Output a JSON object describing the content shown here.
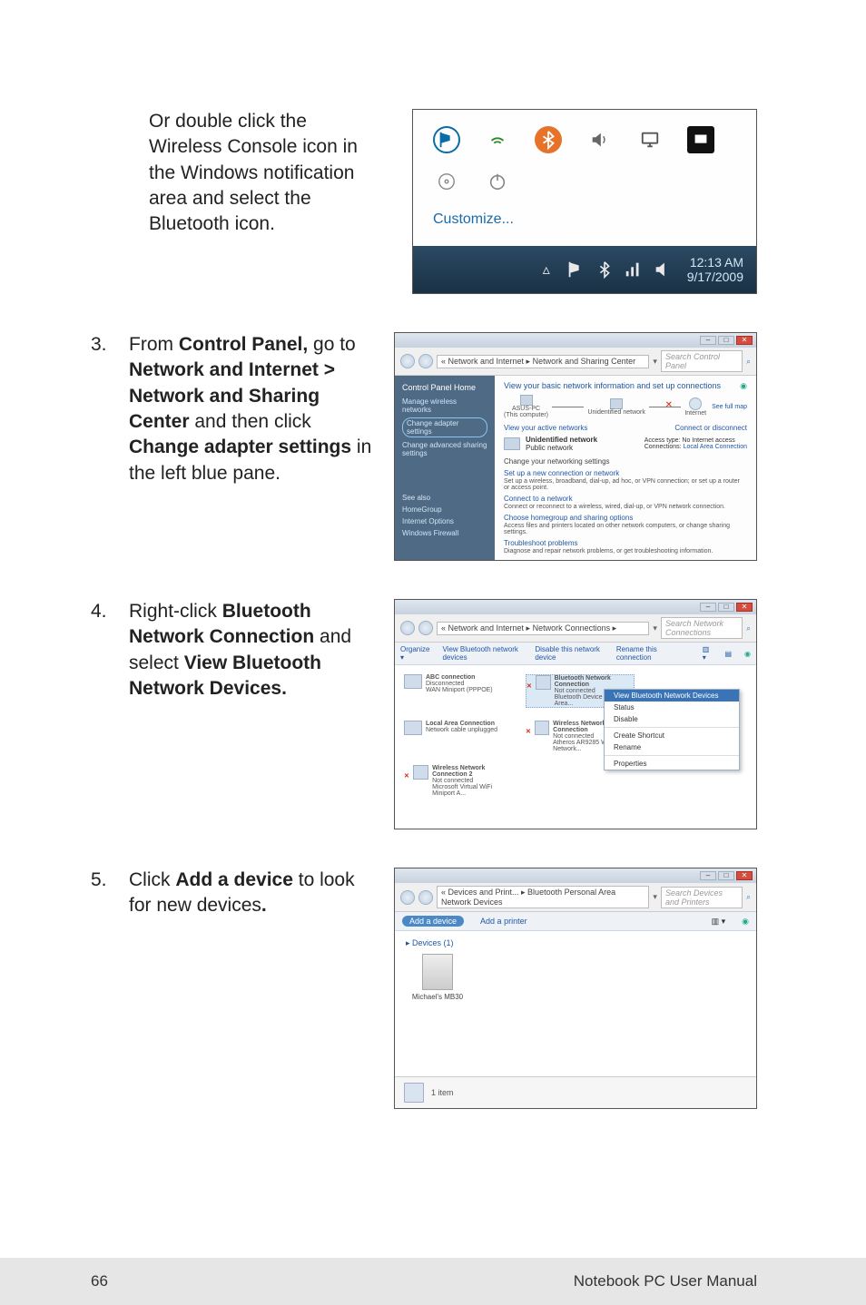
{
  "intro": {
    "text_a": "Or double click the Wireless Console icon in the Windows notification area and select the Bluetooth icon."
  },
  "tray": {
    "customize": "Customize...",
    "time": "12:13 AM",
    "date": "9/17/2009"
  },
  "step3": {
    "num": "3.",
    "t1": "From ",
    "b1": "Control Panel,",
    "t2": " go to ",
    "b2": "Network and Internet > Network and Sharing Center",
    "t3": " and then click ",
    "b3": "Change adapter settings",
    "t4": " in the left blue pane."
  },
  "nc": {
    "breadcrumb": "« Network and Internet ▸ Network and Sharing Center",
    "search": "Search Control Panel",
    "side_home": "Control Panel Home",
    "side_l1": "Manage wireless networks",
    "side_l2": "Change adapter settings",
    "side_l3": "Change advanced sharing settings",
    "see_also": "See also",
    "sa1": "HomeGroup",
    "sa2": "Internet Options",
    "sa3": "Windows Firewall",
    "top": "View your basic network information and set up connections",
    "fullmap": "See full map",
    "node1": "ASUS-PC",
    "node1b": "(This computer)",
    "node2": "Unidentified network",
    "node3": "Internet",
    "active_h": "View your active networks",
    "conn_disc": "Connect or disconnect",
    "net_name": "Unidentified network",
    "net_type": "Public network",
    "acc_type_l": "Access type:",
    "acc_type_v": "No Internet access",
    "conn_l": "Connections:",
    "conn_v": "Local Area Connection",
    "change_h": "Change your networking settings",
    "lk1": "Set up a new connection or network",
    "lk1d": "Set up a wireless, broadband, dial-up, ad hoc, or VPN connection; or set up a router or access point.",
    "lk2": "Connect to a network",
    "lk2d": "Connect or reconnect to a wireless, wired, dial-up, or VPN network connection.",
    "lk3": "Choose homegroup and sharing options",
    "lk3d": "Access files and printers located on other network computers, or change sharing settings.",
    "lk4": "Troubleshoot problems",
    "lk4d": "Diagnose and repair network problems, or get troubleshooting information."
  },
  "step4": {
    "num": "4.",
    "t1": "Right-click ",
    "b1": "Bluetooth Network Connection",
    "t2": " and select ",
    "b2": "View Bluetooth Network Devices."
  },
  "ncwin": {
    "breadcrumb": "« Network and Internet ▸ Network Connections ▸",
    "search": "Search Network Connections",
    "tb1": "Organize ▾",
    "tb2": "View Bluetooth network devices",
    "tb3": "Disable this network device",
    "tb4": "Rename this connection",
    "conn1_t": "ABC connection",
    "conn1_s": "Disconnected",
    "conn1_d": "WAN Miniport (PPPOE)",
    "conn2_t": "Bluetooth Network Connection",
    "conn2_s": "Not connected",
    "conn2_d": "Bluetooth Device (Personal Area...",
    "conn3_t": "Local Area Connection",
    "conn3_s": "Network cable unplugged",
    "conn4_t": "Wireless Network Connection",
    "conn4_s": "Not connected",
    "conn4_d": "Atheros AR9285 Wireless Network...",
    "conn5_t": "Wireless Network Connection 2",
    "conn5_s": "Not connected",
    "conn5_d": "Microsoft Virtual WiFi Miniport A...",
    "menu": {
      "m1": "View Bluetooth Network Devices",
      "m2": "Status",
      "m3": "Disable",
      "m4": "Create Shortcut",
      "m5": "Rename",
      "m6": "Properties"
    }
  },
  "step5": {
    "num": "5.",
    "t1": "Click ",
    "b1": "Add a device",
    "t2": " to look for new devices",
    "b2": "."
  },
  "dev": {
    "breadcrumb": "« Devices and Print... ▸ Bluetooth Personal Area Network Devices",
    "search": "Search Devices and Printers",
    "add_device": "Add a device",
    "add_printer": "Add a printer",
    "group": "▸ Devices (1)",
    "item": "Michael's MB30",
    "status": "1 item"
  },
  "footer": {
    "page": "66",
    "title": "Notebook PC User Manual"
  }
}
